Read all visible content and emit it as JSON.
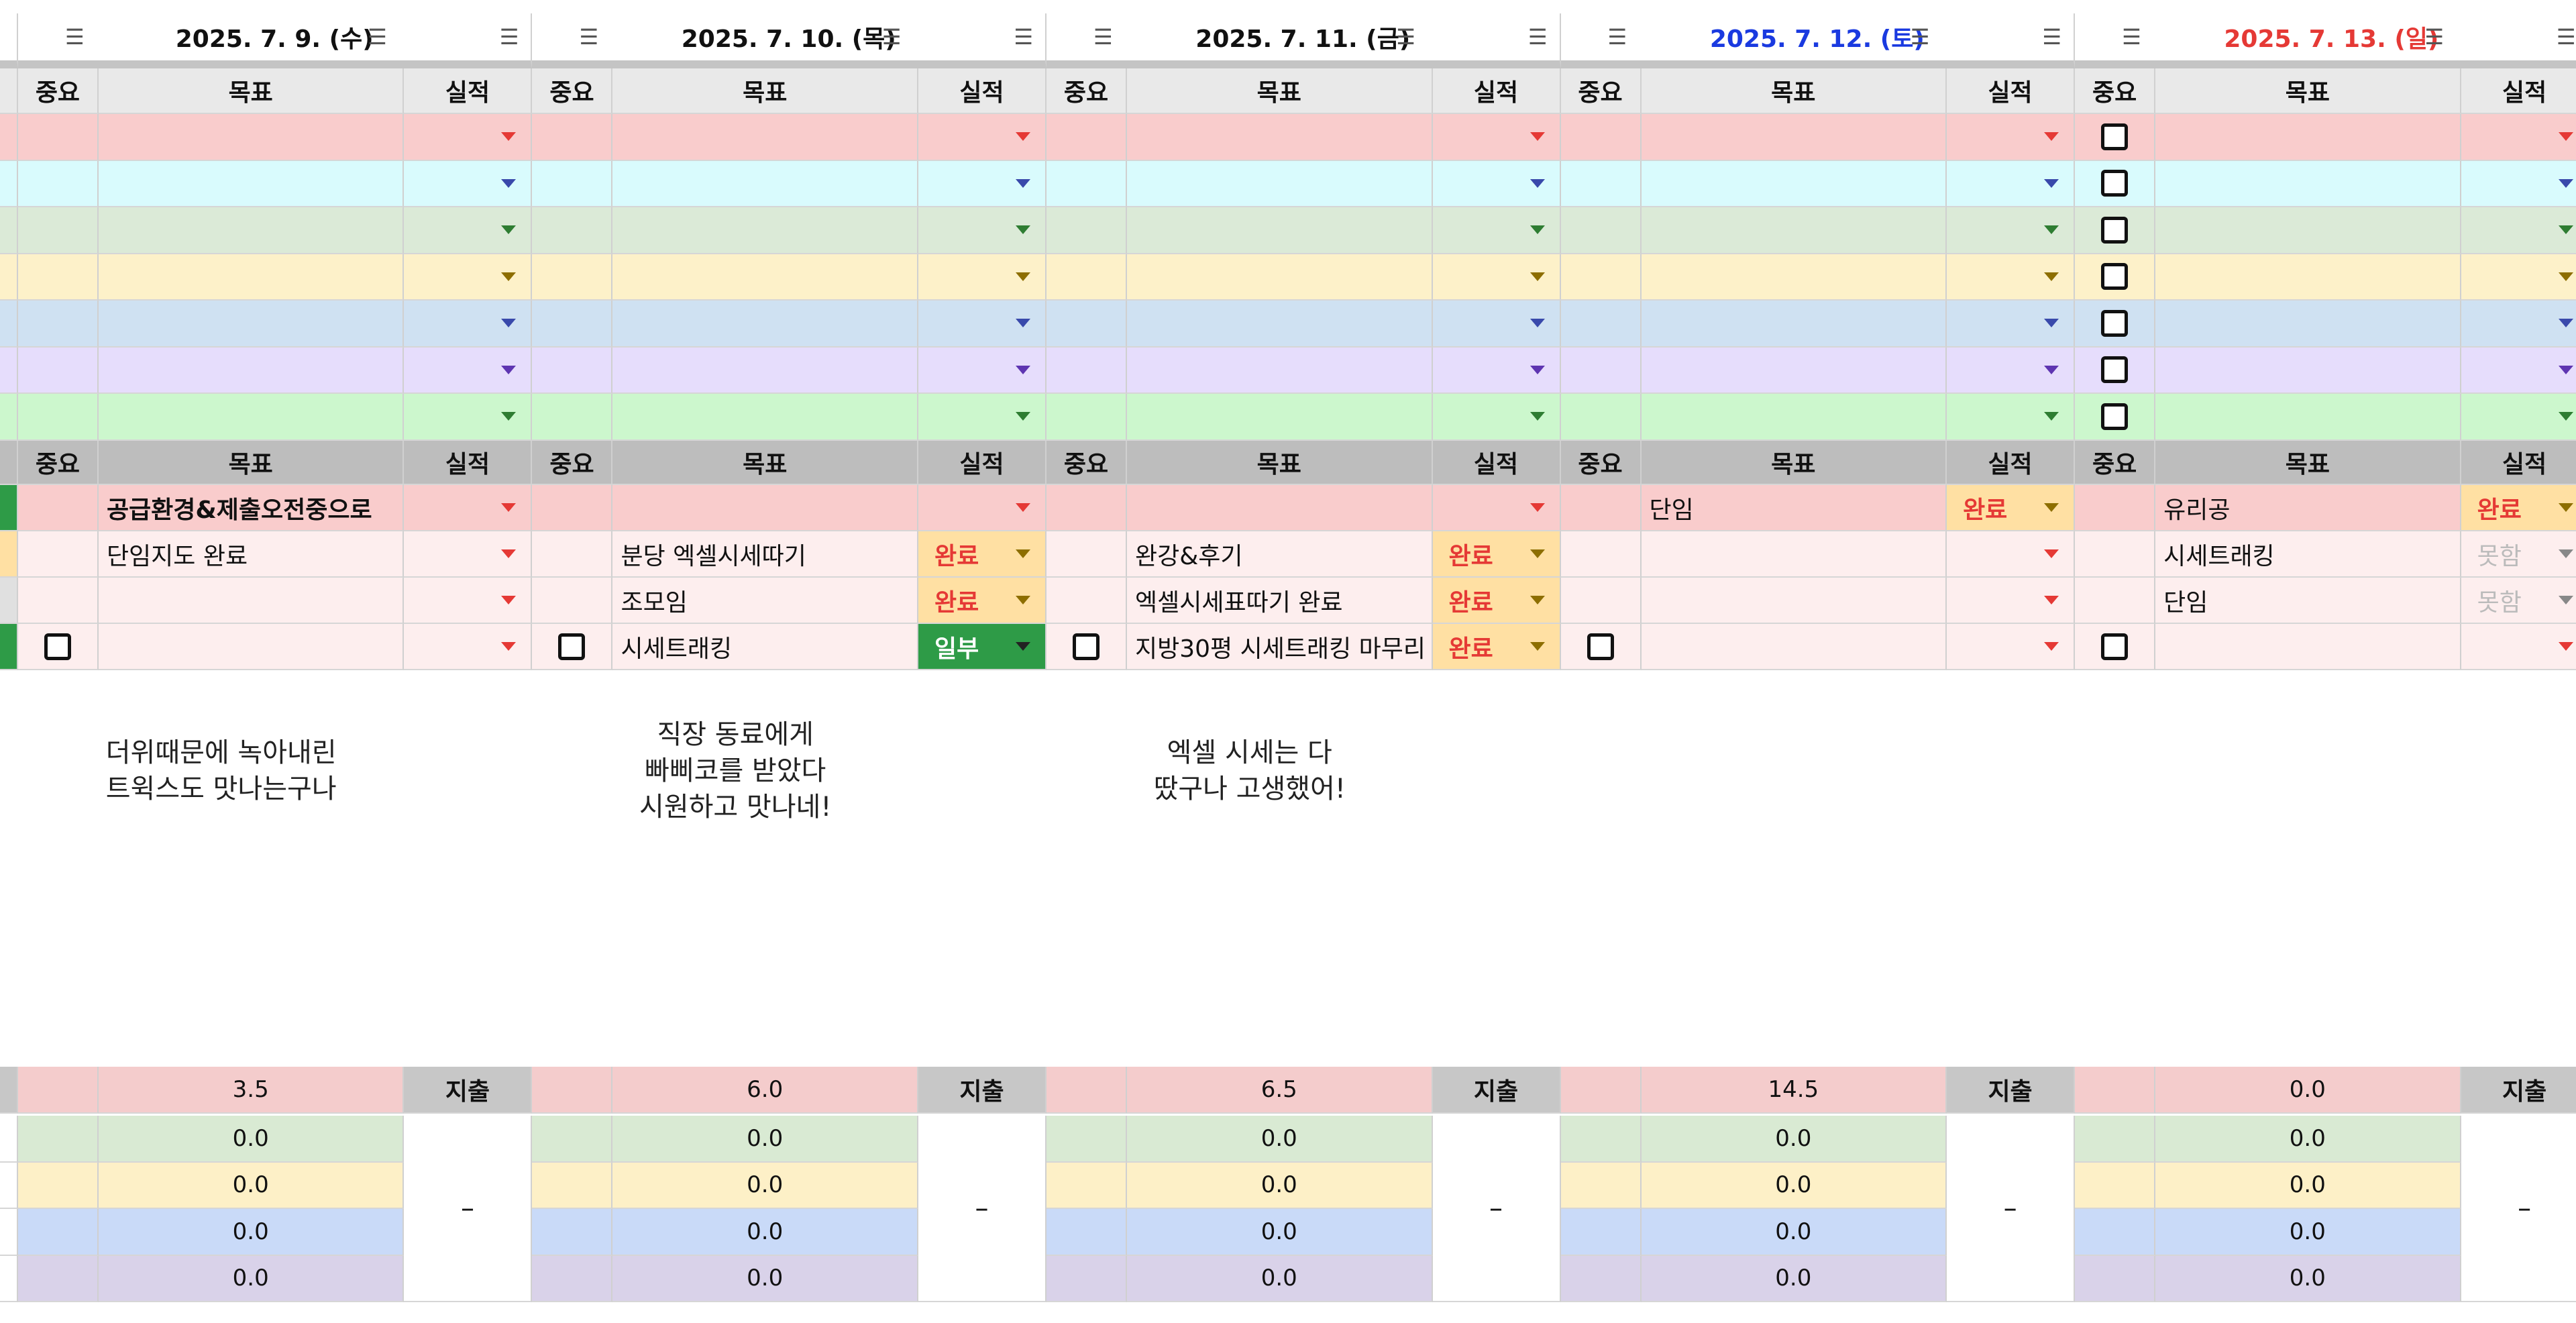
{
  "headers": {
    "important": "중요",
    "goal": "목표",
    "result": "실적",
    "spend": "지출",
    "dash": "–"
  },
  "days": [
    {
      "date": "2025. 7. 9. (수)",
      "date_color": "#111111",
      "goals": [
        {
          "goal": "공급환경&제출오전중으로",
          "status": "",
          "bold": true,
          "checkbox": false
        },
        {
          "goal": "단임지도 완료",
          "status": "",
          "checkbox": false
        },
        {
          "goal": "",
          "status": "",
          "checkbox": false
        },
        {
          "goal": "",
          "status": "",
          "checkbox": true
        }
      ],
      "memo": "더위때문에 녹아내린\n트윅스도 맛나는구나",
      "total": "3.5",
      "sub": [
        "0.0",
        "0.0",
        "0.0",
        "0.0"
      ]
    },
    {
      "date": "2025. 7. 10. (목)",
      "date_color": "#111111",
      "goals": [
        {
          "goal": "",
          "status": "",
          "checkbox": false
        },
        {
          "goal": "분당 엑셀시세따기",
          "status": "완료",
          "checkbox": false
        },
        {
          "goal": "조모임",
          "status": "완료",
          "checkbox": false
        },
        {
          "goal": "시세트래킹",
          "status": "일부",
          "checkbox": true
        }
      ],
      "memo": "직장 동료에게\n빠삐코를 받았다\n시원하고 맛나네!",
      "total": "6.0",
      "sub": [
        "0.0",
        "0.0",
        "0.0",
        "0.0"
      ]
    },
    {
      "date": "2025. 7. 11. (금)",
      "date_color": "#111111",
      "goals": [
        {
          "goal": "",
          "status": "",
          "checkbox": false
        },
        {
          "goal": "완강&후기",
          "status": "완료",
          "checkbox": false
        },
        {
          "goal": "엑셀시세표따기 완료",
          "status": "완료",
          "checkbox": false
        },
        {
          "goal": "지방30평 시세트래킹 마무리",
          "status": "완료",
          "checkbox": true
        }
      ],
      "memo": "엑셀 시세는 다\n땄구나 고생했어!",
      "total": "6.5",
      "sub": [
        "0.0",
        "0.0",
        "0.0",
        "0.0"
      ]
    },
    {
      "date": "2025. 7. 12. (토)",
      "date_color": "#1a3ae0",
      "goals": [
        {
          "goal": "단임",
          "status": "완료",
          "checkbox": false
        },
        {
          "goal": "",
          "status": "",
          "checkbox": false
        },
        {
          "goal": "",
          "status": "",
          "checkbox": false
        },
        {
          "goal": "",
          "status": "",
          "checkbox": true
        }
      ],
      "memo": "",
      "total": "14.5",
      "sub": [
        "0.0",
        "0.0",
        "0.0",
        "0.0"
      ]
    },
    {
      "date": "2025. 7. 13. (일)",
      "date_color": "#e53935",
      "goals": [
        {
          "goal": "유리공",
          "status": "완료",
          "checkbox": false
        },
        {
          "goal": "시세트래킹",
          "status": "못함",
          "checkbox": false
        },
        {
          "goal": "단임",
          "status": "못함",
          "checkbox": false
        },
        {
          "goal": "",
          "status": "",
          "checkbox": true
        }
      ],
      "memo": "",
      "total": "0.0",
      "sub": [
        "0.0",
        "0.0",
        "0.0",
        "0.0"
      ]
    }
  ],
  "colors": {
    "rows": [
      "#f9cccc",
      "#d9fbfd",
      "#dbead7",
      "#fdf1c9",
      "#cfe1f2",
      "#e6ddfc",
      "#ccf7cd"
    ],
    "row_arrows": [
      "red",
      "blue",
      "green",
      "olive",
      "blue",
      "purple",
      "green"
    ],
    "goal_bg": "#fdeeee",
    "goal_first_bg": "#f9cccc",
    "sub_bg": [
      "#d9ead3",
      "#fdf0c7",
      "#c9daf8",
      "#d9d2e9"
    ],
    "total_bg": "#f4cccc"
  }
}
